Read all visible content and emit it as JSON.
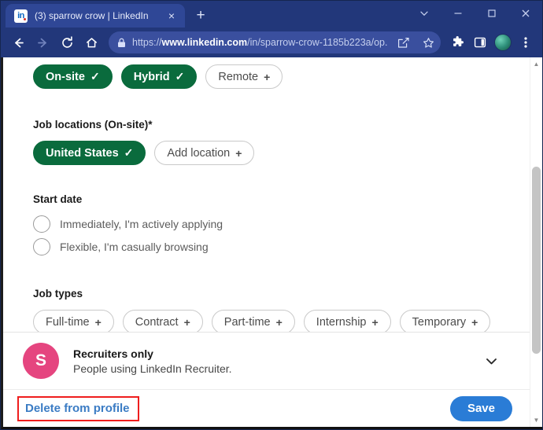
{
  "browser": {
    "tab": {
      "favicon_text": "in",
      "title": "(3) sparrow crow | LinkedIn",
      "close_label": "×"
    },
    "new_tab_label": "+",
    "window_controls": {
      "tab_search": "tab-search",
      "minimize": "minimize",
      "maximize": "maximize",
      "close": "close"
    },
    "nav": {
      "back": "back",
      "forward": "forward",
      "reload": "reload",
      "home": "home"
    },
    "omnibox": {
      "scheme": "https://",
      "domain": "www.linkedin.com",
      "path": "/in/sparrow-crow-1185b223a/op...",
      "full_url": "https://www.linkedin.com/in/sparrow-crow-1185b223a/op...",
      "lock_icon": "lock-icon",
      "share_icon": "share-icon",
      "bookmark_icon": "star-icon"
    },
    "toolbar": {
      "extensions": "puzzle-icon",
      "side_panel": "side-panel-icon",
      "profile": "profile-avatar",
      "menu": "three-dot-menu"
    }
  },
  "page": {
    "workplace_chips": [
      {
        "label": "On-site",
        "selected": true,
        "mark": "✓"
      },
      {
        "label": "Hybrid",
        "selected": true,
        "mark": "✓"
      },
      {
        "label": "Remote",
        "selected": false,
        "mark": "+"
      }
    ],
    "job_locations": {
      "label": "Job locations (On-site)*",
      "chips": [
        {
          "label": "United States",
          "selected": true,
          "mark": "✓"
        },
        {
          "label": "Add location",
          "selected": false,
          "mark": "+"
        }
      ]
    },
    "start_date": {
      "label": "Start date",
      "options": [
        {
          "label": "Immediately, I'm actively applying",
          "selected": false
        },
        {
          "label": "Flexible, I'm casually browsing",
          "selected": false
        }
      ]
    },
    "job_types": {
      "label": "Job types",
      "chips": [
        {
          "label": "Full-time",
          "selected": false,
          "mark": "+"
        },
        {
          "label": "Contract",
          "selected": false,
          "mark": "+"
        },
        {
          "label": "Part-time",
          "selected": false,
          "mark": "+"
        },
        {
          "label": "Internship",
          "selected": false,
          "mark": "+"
        },
        {
          "label": "Temporary",
          "selected": false,
          "mark": "+"
        }
      ]
    },
    "recruiters": {
      "avatar_letter": "S",
      "title": "Recruiters only",
      "subtitle": "People using LinkedIn Recruiter.",
      "expand_icon": "chevron-down-icon"
    },
    "footer": {
      "delete_label": "Delete from profile",
      "save_label": "Save"
    }
  },
  "colors": {
    "chrome_frame": "#22377a",
    "chip_selected": "#0a6b3d",
    "save_button": "#2a7cd6",
    "delete_link": "#3b7cc4",
    "highlight_box": "#ef1d1d",
    "avatar_pink": "#e5457f"
  }
}
